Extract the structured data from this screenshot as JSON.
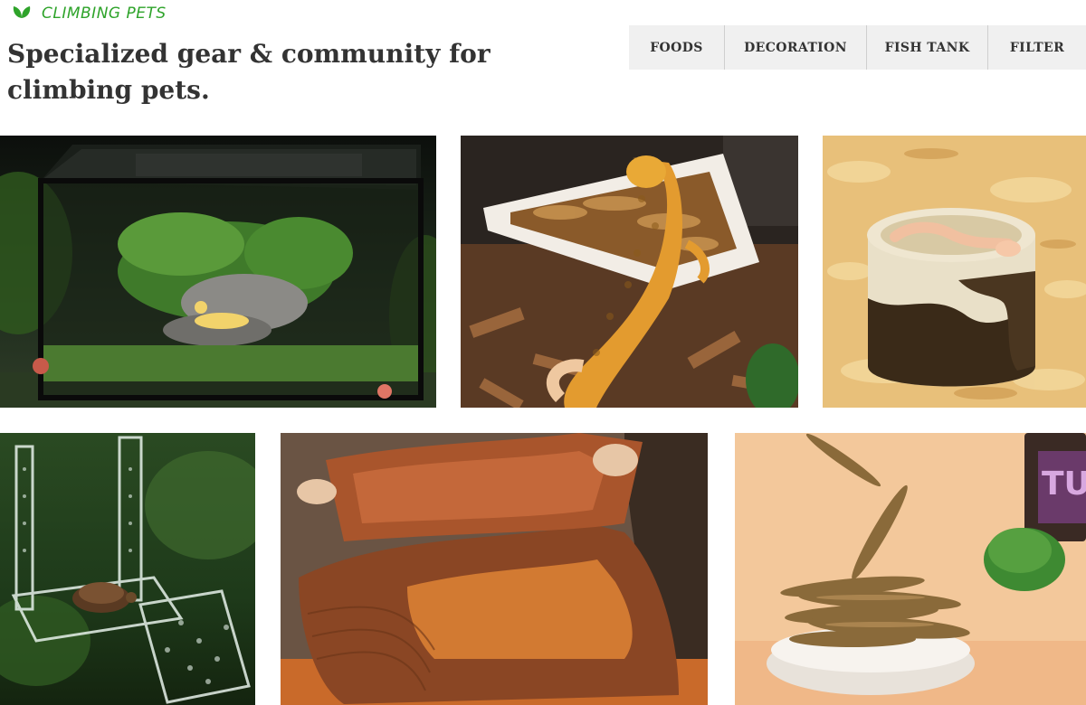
{
  "brand": {
    "name": "CLIMBING PETS",
    "icon": "leaf-icon",
    "color": "#2ea32a"
  },
  "tagline": "Specialized gear & community for climbing pets.",
  "nav": {
    "items": [
      {
        "label": "FOODS"
      },
      {
        "label": "DECORATION"
      },
      {
        "label": "FISH TANK"
      },
      {
        "label": "FILTER"
      }
    ]
  },
  "gallery": {
    "items": [
      {
        "subject": "glass terrarium with gecko"
      },
      {
        "subject": "leopard gecko on feeding dish"
      },
      {
        "subject": "snake in ceramic water bowl"
      },
      {
        "subject": "acrylic turtle basking platform"
      },
      {
        "subject": "sand tray hide"
      },
      {
        "subject": "dried fish treats"
      }
    ],
    "jar_label": "TU"
  }
}
